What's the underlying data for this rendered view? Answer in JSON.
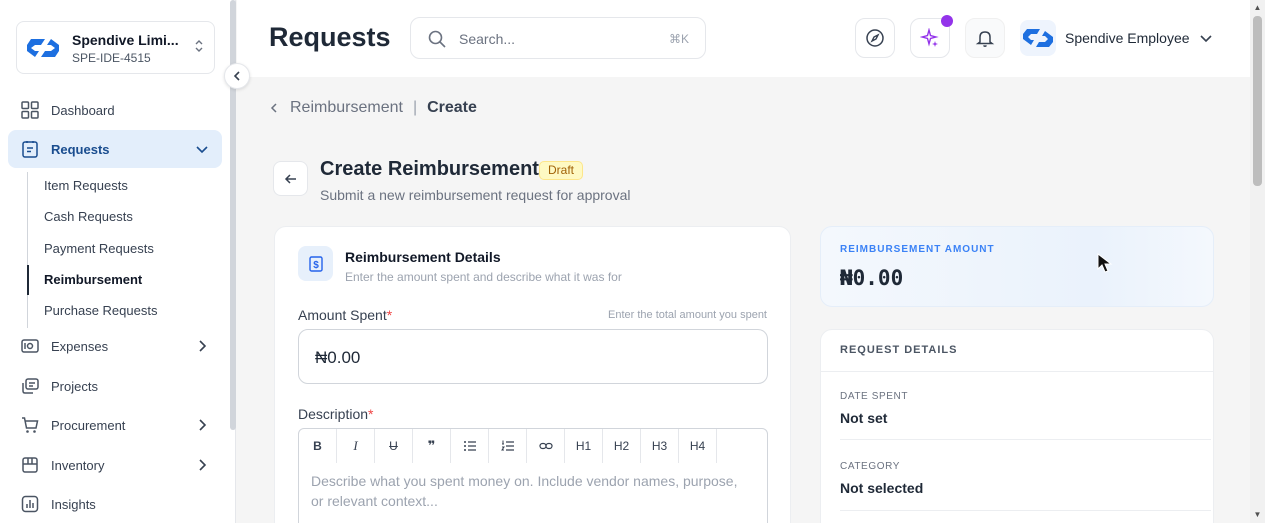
{
  "org": {
    "name": "Spendive Limi...",
    "code": "SPE-IDE-4515"
  },
  "sidebar": {
    "items": [
      {
        "label": "Dashboard"
      },
      {
        "label": "Requests"
      },
      {
        "label": "Expenses"
      },
      {
        "label": "Projects"
      },
      {
        "label": "Procurement"
      },
      {
        "label": "Inventory"
      },
      {
        "label": "Insights"
      }
    ],
    "subitems": [
      {
        "label": "Item Requests"
      },
      {
        "label": "Cash Requests"
      },
      {
        "label": "Payment Requests"
      },
      {
        "label": "Reimbursement"
      },
      {
        "label": "Purchase Requests"
      }
    ]
  },
  "header": {
    "title": "Requests",
    "search_placeholder": "Search...",
    "search_shortcut": "⌘K",
    "user_name": "Spendive Employee"
  },
  "breadcrumb": {
    "parent": "Reimbursement",
    "separator": "|",
    "current": "Create"
  },
  "page": {
    "title": "Create Reimbursement",
    "badge": "Draft",
    "subtitle": "Submit a new reimbursement request for approval"
  },
  "form": {
    "title": "Reimbursement Details",
    "subtitle": "Enter the amount spent and describe what it was for",
    "amount_label": "Amount Spent",
    "required_mark": "*",
    "amount_hint": "Enter the total amount you spent",
    "amount_value": "₦0.00",
    "description_label": "Description",
    "toolbar": [
      "B",
      "I",
      "U",
      "❞",
      "list",
      "ol",
      "link",
      "H1",
      "H2",
      "H3",
      "H4"
    ],
    "description_placeholder": "Describe what you spent money on. Include vendor names, purpose, or relevant context..."
  },
  "summary": {
    "amount_label": "REIMBURSEMENT AMOUNT",
    "amount_value": "₦0.00",
    "details_title": "REQUEST DETAILS",
    "date_label": "DATE SPENT",
    "date_value": "Not set",
    "category_label": "CATEGORY",
    "category_value": "Not selected"
  },
  "colors": {
    "brand": "#2563eb",
    "active_bg": "#e3eefb",
    "badge_bg": "#fef9c3",
    "notification": "#9333ea"
  }
}
